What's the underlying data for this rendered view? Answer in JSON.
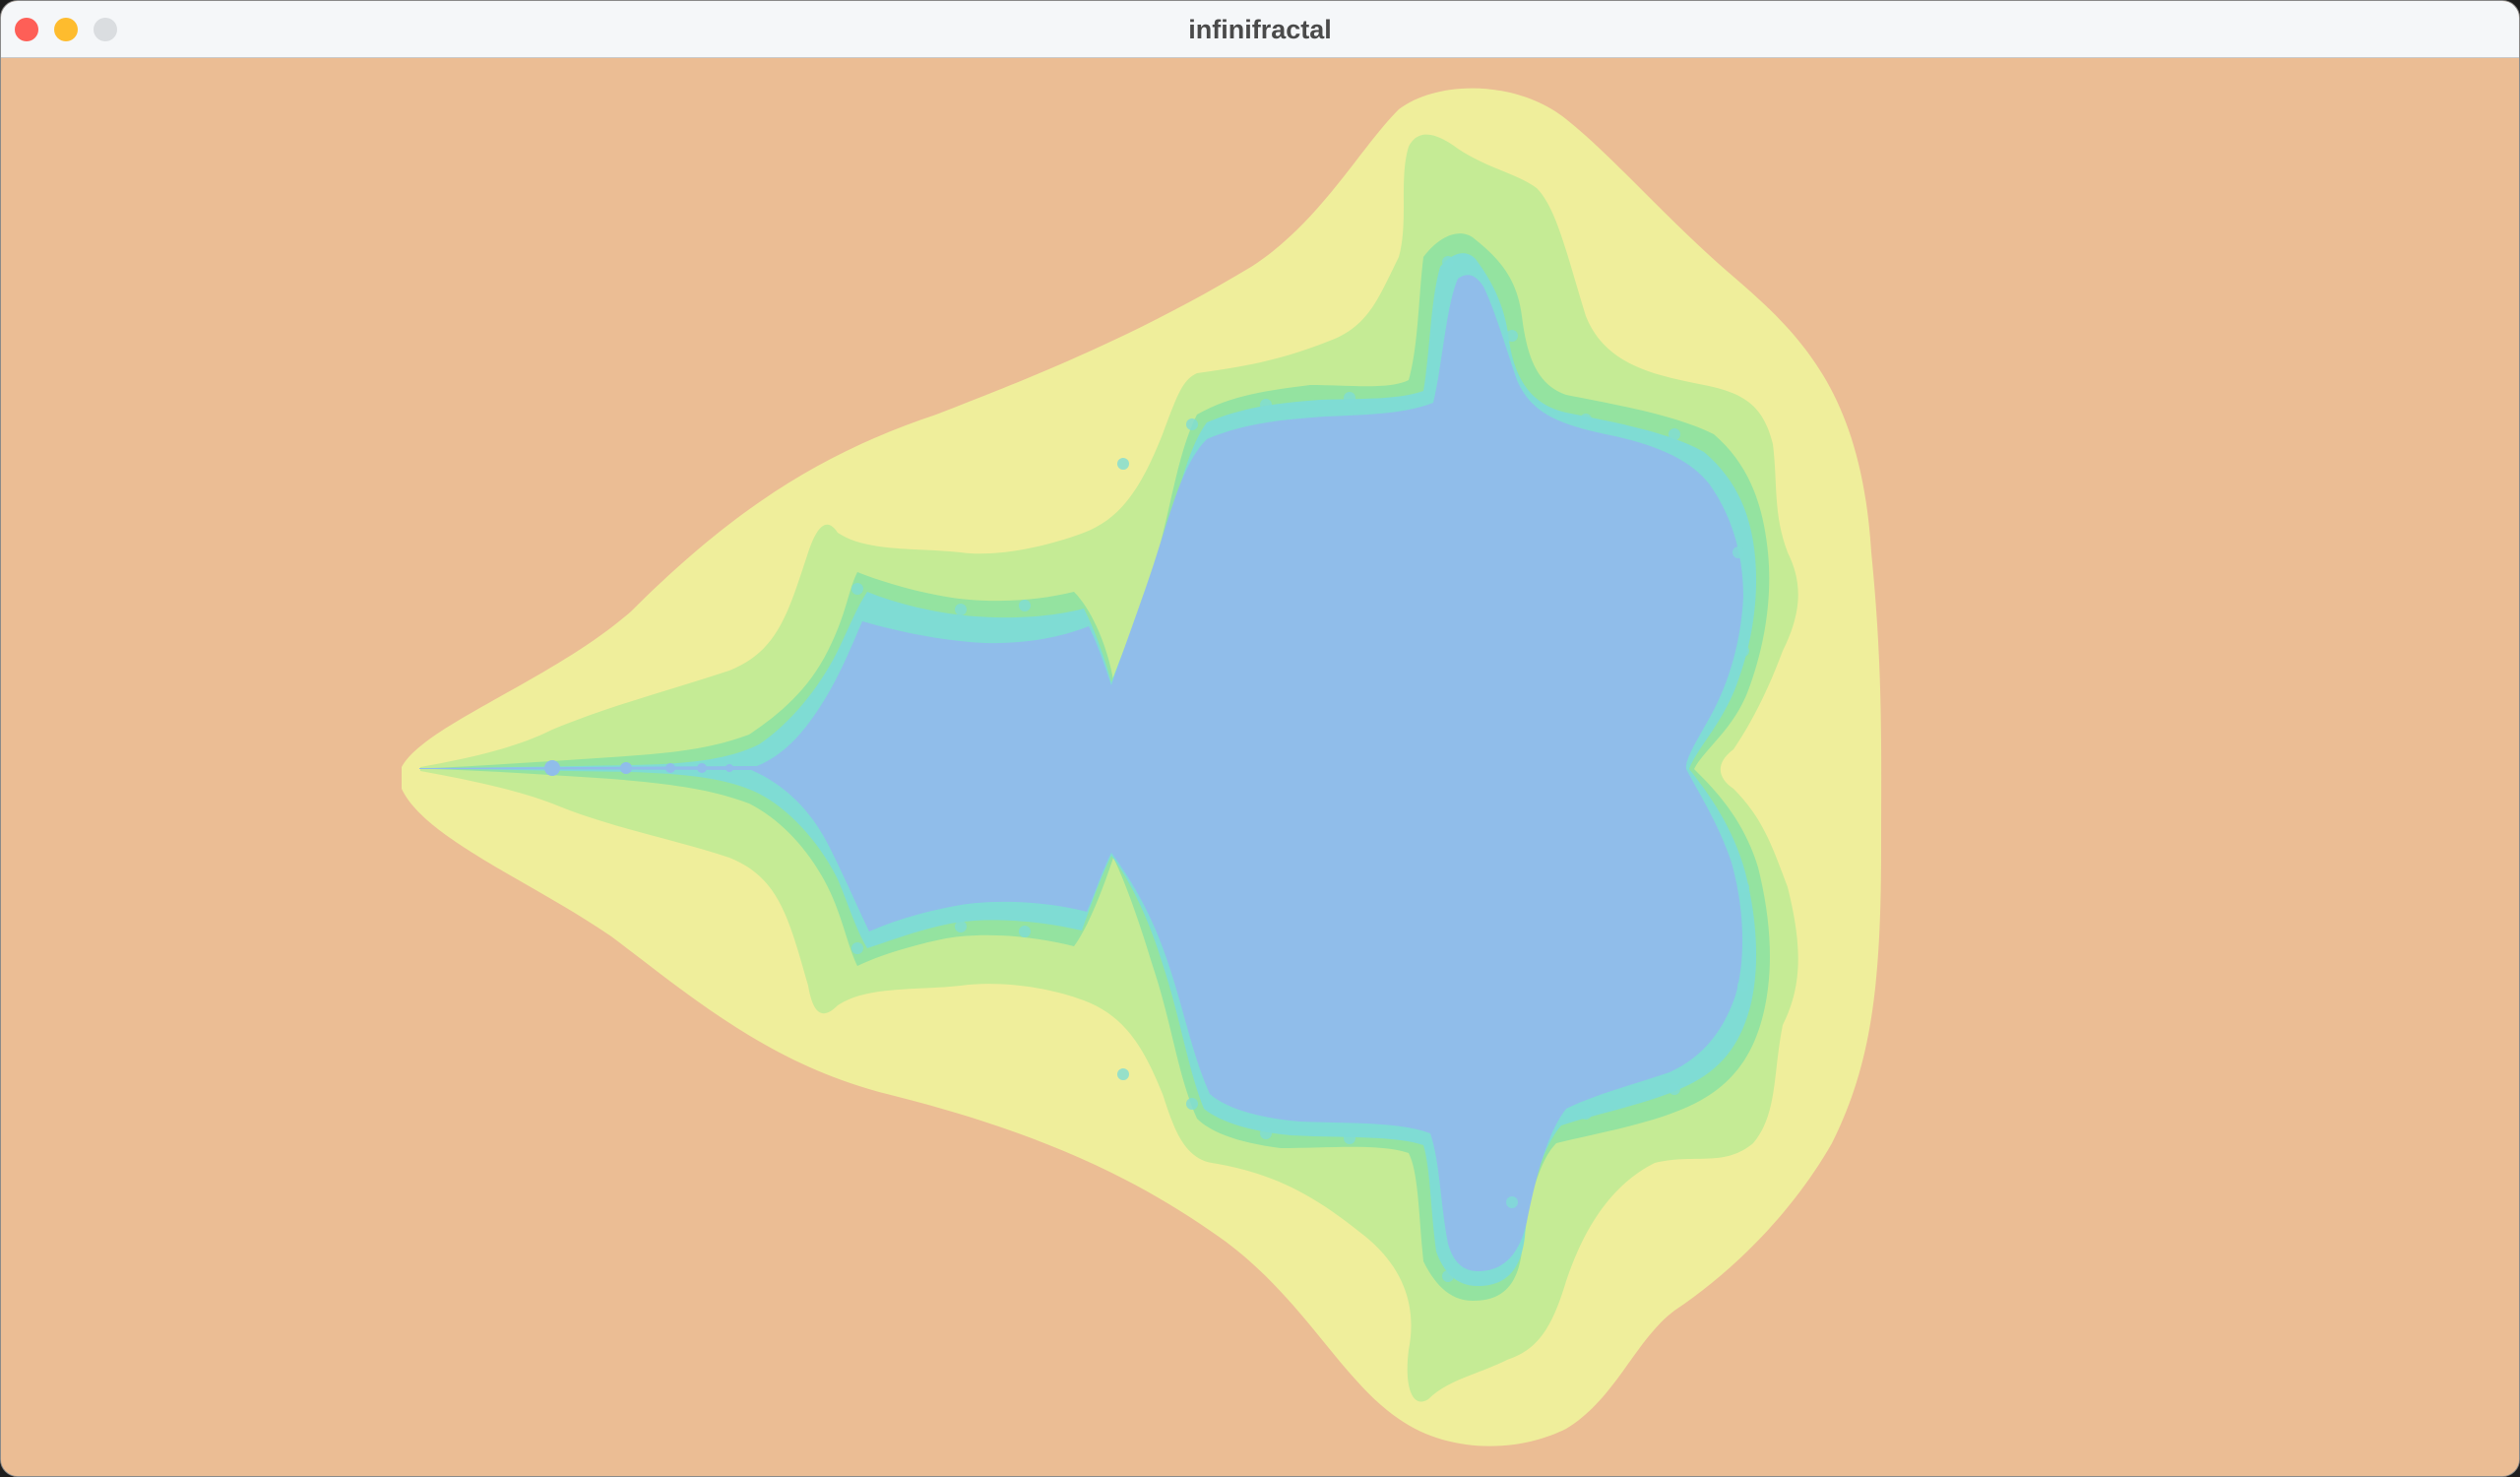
{
  "window": {
    "title": "infinifractal",
    "controls": {
      "close_color": "#fe5f57",
      "minimize_color": "#febc2e",
      "zoom_color": "#dadde0"
    }
  },
  "fractal": {
    "set": "Mandelbrot",
    "palette": {
      "background": "#ebbd94",
      "band_outer": "#efee9b",
      "band_mid": "#c5eb95",
      "band_inner": "#94e3a0",
      "edge": "#7fdcd4",
      "interior": "#90bdea"
    }
  }
}
